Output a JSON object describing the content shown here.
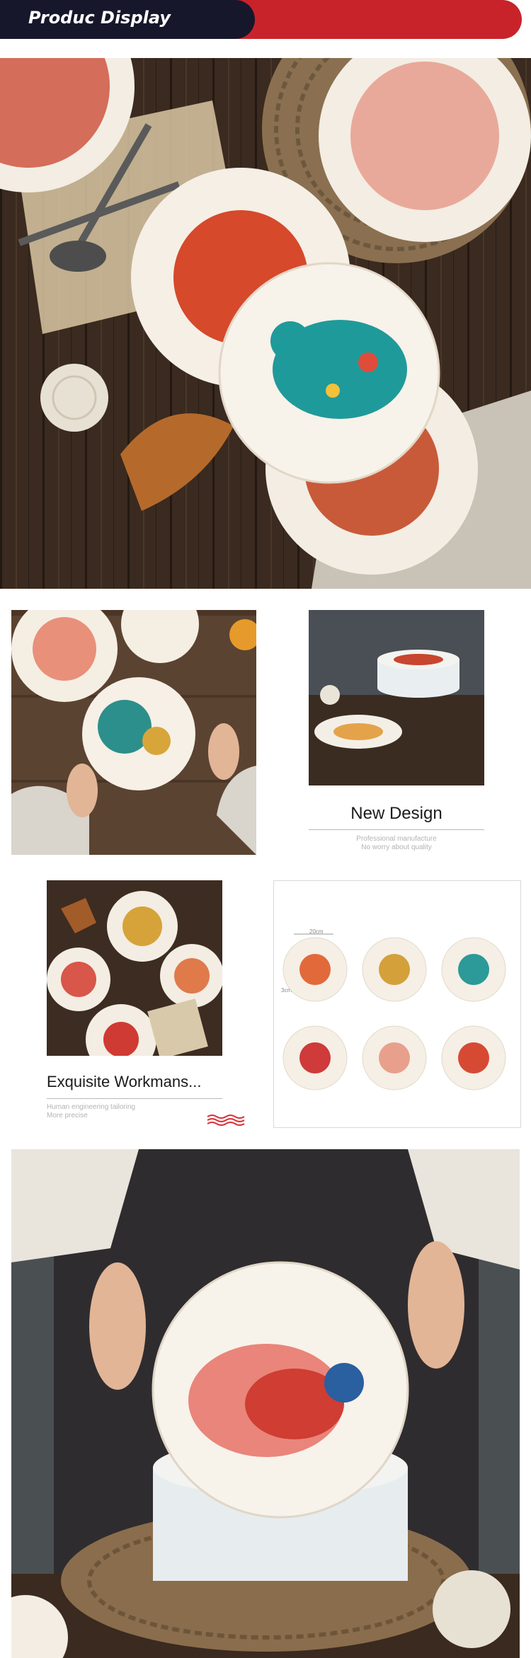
{
  "header": {
    "title": "Produc Display"
  },
  "section_new_design": {
    "title": "New Design",
    "subtitle_1": "Professional manufacture",
    "subtitle_2": "No worry about quality"
  },
  "section_workmanship": {
    "title": "Exquisite Workmans...",
    "subtitle_1": "Human engineering tailoring",
    "subtitle_2": "More precise"
  },
  "size_chart": {
    "diameter_label": "20cm",
    "height_label": "3cm"
  },
  "colors": {
    "banner_red": "#c8232a",
    "banner_dark": "#16172b",
    "accent_wave": "#d8353b"
  }
}
